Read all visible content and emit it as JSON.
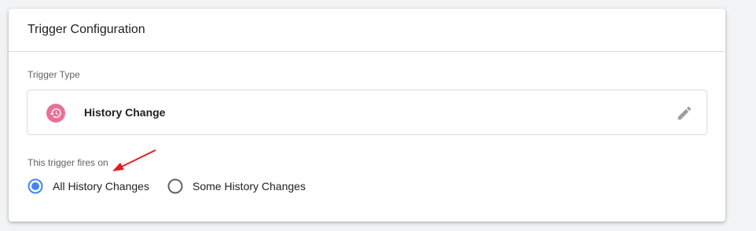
{
  "card": {
    "title": "Trigger Configuration"
  },
  "trigger_type": {
    "label": "Trigger Type",
    "name": "History Change",
    "icon": "history-icon",
    "icon_color": "#e8719a",
    "edit_icon": "pencil-icon"
  },
  "fires_on": {
    "label": "This trigger fires on",
    "options": [
      {
        "label": "All History Changes",
        "selected": true
      },
      {
        "label": "Some History Changes",
        "selected": false
      }
    ]
  },
  "colors": {
    "accent": "#4285f4",
    "annotation": "#e51c23"
  }
}
